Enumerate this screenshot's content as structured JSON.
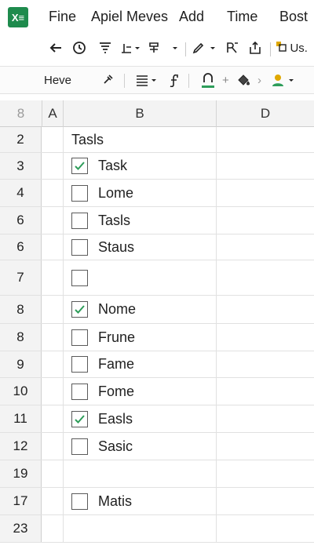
{
  "app": {
    "logo_text": "X≡",
    "brand_color": "#1e8b4d",
    "accent_check_color": "#2e9d5a"
  },
  "menu": [
    "Fine",
    "Apiel Meves",
    "Add",
    "Time",
    "Bost"
  ],
  "toolbar": {
    "icons": [
      "back-arrow-icon",
      "clock-icon",
      "filter-icon",
      "insert-icon",
      "layout-icon",
      "pen-icon",
      "text-direction-icon",
      "share-icon",
      "user-icon"
    ],
    "user_label": "Us."
  },
  "formula_bar": {
    "name_box": "Heve",
    "icons": [
      "tools-icon",
      "align-icon",
      "function-icon",
      "underline-color-icon",
      "plus-icon",
      "paint-icon",
      "arrow-icon",
      "people-icon"
    ]
  },
  "grid": {
    "corner_label": "8",
    "columns": [
      "A",
      "B",
      "D"
    ],
    "rows": [
      {
        "num": "2",
        "checkbox": null,
        "text": "Tasls"
      },
      {
        "num": "3",
        "checkbox": true,
        "text": "Task"
      },
      {
        "num": "4",
        "checkbox": false,
        "text": "Lome"
      },
      {
        "num": "6",
        "checkbox": false,
        "text": "Tasls"
      },
      {
        "num": "6",
        "checkbox": false,
        "text": "Staus"
      },
      {
        "num": "7",
        "checkbox": false,
        "text": ""
      },
      {
        "num": "8",
        "checkbox": true,
        "text": "Nome"
      },
      {
        "num": "8",
        "checkbox": false,
        "text": "Frune"
      },
      {
        "num": "9",
        "checkbox": false,
        "text": "Fame"
      },
      {
        "num": "10",
        "checkbox": false,
        "text": "Fome"
      },
      {
        "num": "11",
        "checkbox": true,
        "text": "Easls"
      },
      {
        "num": "12",
        "checkbox": false,
        "text": "Sasic"
      },
      {
        "num": "19",
        "checkbox": null,
        "text": ""
      },
      {
        "num": "17",
        "checkbox": false,
        "text": "Matis"
      },
      {
        "num": "23",
        "checkbox": null,
        "text": ""
      }
    ]
  }
}
